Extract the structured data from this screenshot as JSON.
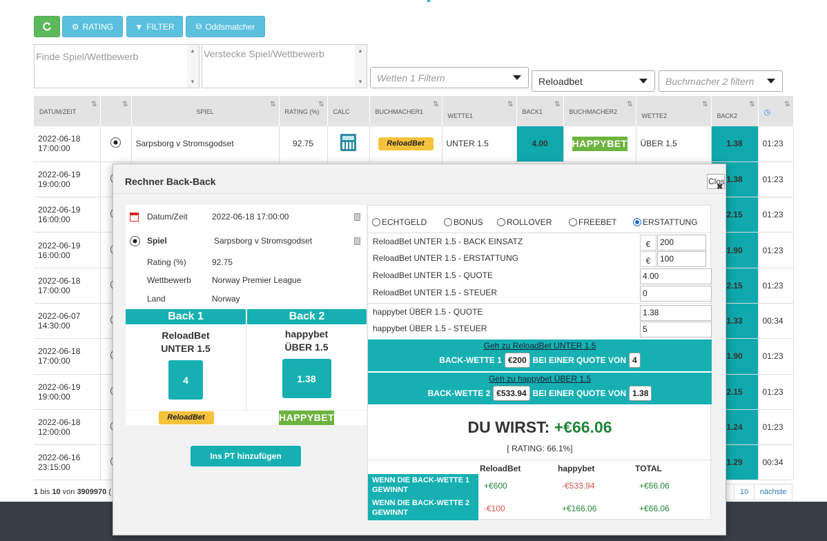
{
  "toolbar": {
    "refresh_icon": "refresh-icon",
    "rating_label": "RATING",
    "filter_label": "FILTER",
    "oddsmatcher_label": "Oddsmatcher",
    "colors": {
      "green": "#5cb85c",
      "blue": "#5bc0de"
    }
  },
  "filters": {
    "find_placeholder": "Finde Spiel/Wettbewerb",
    "hide_placeholder": "Verstecke Spiel/Wettbewerb",
    "bets_placeholder": "Wetten 1 Filtern",
    "bookmaker1_value": "Reloadbet",
    "bookmaker2_placeholder": "Buchmacher 2 filtern"
  },
  "table": {
    "headers": [
      "DATUM/ZEIT",
      "",
      "SPIEL",
      "RATING (%)",
      "CALC",
      "BUCHMACHER1",
      "WETTE1",
      "BACK1",
      "BUCHMACHER2",
      "WETTE2",
      "BACK2",
      "clock-icon"
    ],
    "sort_icon": "⇅",
    "rows": [
      {
        "date": "2022-06-18",
        "time": "17:00:00",
        "game": "Sarpsborg v Stromsgodset",
        "rating": "92.75",
        "bm1": "ReloadBet",
        "bet1": "UNTER 1.5",
        "back1": "4.00",
        "bm2": "HAPPYBET",
        "bet2": "ÜBER 1.5",
        "back2": "1.38",
        "clock": "01:23"
      },
      {
        "date": "2022-06-19",
        "time": "19:00:00",
        "back2": "1.38",
        "clock": "01:23"
      },
      {
        "date": "2022-06-19",
        "time": "16:00:00",
        "back2": "2.15",
        "clock": "01:23"
      },
      {
        "date": "2022-06-19",
        "time": "16:00:00",
        "back2": "1.90",
        "clock": "01:23"
      },
      {
        "date": "2022-06-18",
        "time": "17:00:00",
        "back2": "2.15",
        "clock": "01:23"
      },
      {
        "date": "2022-06-07",
        "time": "14:30:00",
        "back2": "1.33",
        "clock": "00:34"
      },
      {
        "date": "2022-06-18",
        "time": "17:00:00",
        "back2": "1.90",
        "clock": "01:23"
      },
      {
        "date": "2022-06-19",
        "time": "19:00:00",
        "back2": "2.15",
        "clock": "01:23"
      },
      {
        "date": "2022-06-18",
        "time": "12:00:00",
        "back2": "1.24",
        "clock": "01:23"
      },
      {
        "date": "2022-06-16",
        "time": "23:15:00",
        "back2": "1.29",
        "clock": "00:34"
      }
    ]
  },
  "pagination": {
    "from": "1",
    "bis": "bis",
    "to": "10",
    "von": "von",
    "total": "3909970",
    "tail": "(",
    "page": "10",
    "next": "nächste"
  },
  "modal": {
    "title": "Rechner Back-Back",
    "close_label": "Close",
    "info": {
      "date_label": "Datum/Zeit",
      "date_value": "2022-06-18 17:00:00",
      "game_label": "Spiel",
      "game_value": "Sarpsborg v Stromsgodset",
      "rating_label": "Rating (%)",
      "rating_value": "92.75",
      "comp_label": "Wettbewerb",
      "comp_value": "Norway Premier League",
      "country_label": "Land",
      "country_value": "Norway"
    },
    "back1": {
      "head": "Back 1",
      "bookmaker": "ReloadBet",
      "bet": "UNTER 1.5",
      "odds": "4",
      "logo": "ReloadBet"
    },
    "back2": {
      "head": "Back 2",
      "bookmaker": "happybet",
      "bet": "ÜBER 1.5",
      "odds": "1.38",
      "logo": "HAPPYBET"
    },
    "pt_button": "Ins PT hinzufügen",
    "radio_options": [
      "ECHTGELD",
      "BONUS",
      "ROLLOVER",
      "FREEBET",
      "ERSTATTUNG"
    ],
    "radio_selected": "ERSTATTUNG",
    "fields": [
      {
        "label": "ReloadBet UNTER 1.5 - BACK EINSATZ",
        "currency": "€",
        "value": "200"
      },
      {
        "label": "ReloadBet UNTER 1.5 - ERSTATTUNG",
        "currency": "€",
        "value": "100"
      },
      {
        "label": "ReloadBet UNTER 1.5 - QUOTE",
        "value": "4.00"
      },
      {
        "label": "ReloadBet UNTER 1.5 - STEUER",
        "value": "0"
      },
      {
        "label": "happybet ÜBER 1.5  - QUOTE",
        "value": "1.38"
      },
      {
        "label": "happybet ÜBER 1.5 - STEUER",
        "value": "5"
      }
    ],
    "bet1_bar": {
      "link": "Geh zu ReloadBet UNTER 1.5",
      "prefix": "BACK-WETTE 1",
      "stake": "€200",
      "mid": "BEI EINER QUOTE VON",
      "odds": "4"
    },
    "bet2_bar": {
      "link": "Geh zu happybet ÜBER 1.5",
      "prefix": "BACK-WETTE 2",
      "stake": "€533.94",
      "mid": "BEI EINER QUOTE VON",
      "odds": "1.38"
    },
    "result_label": "DU WIRST:",
    "result_value": "+€66.06",
    "rating_text": "[ RATING: 66.1%]",
    "result_headers": [
      "ReloadBet",
      "happybet",
      "TOTAL"
    ],
    "result_rows": [
      {
        "label": "WENN DIE BACK-WETTE 1 GEWINNT",
        "v1": "+€600",
        "v2": "-€533.94",
        "total": "+€66.06"
      },
      {
        "label": "WENN DIE BACK-WETTE 2 GEWINNT",
        "v1": "-€100",
        "v2": "+€166.06",
        "total": "+€66.06"
      }
    ],
    "accent": "#16b0b2"
  }
}
